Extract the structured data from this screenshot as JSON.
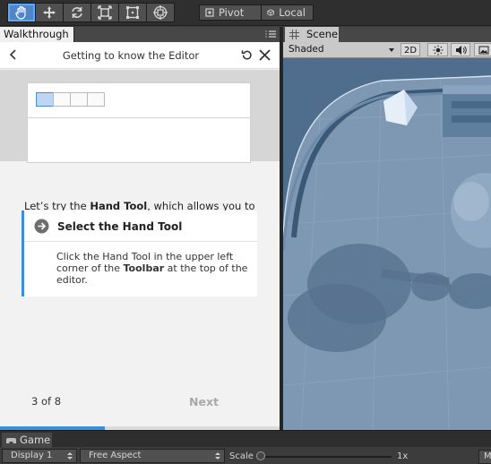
{
  "toolbar": {
    "pivot_label": "Pivot",
    "local_label": "Local",
    "accent": "#4e86c8"
  },
  "walkthrough": {
    "tab_label": "Walkthrough",
    "header_title": "Getting to know the Editor",
    "lead_prefix": "Let’s try the ",
    "lead_bold": "Hand Tool",
    "lead_suffix": ", which allows you to navigate your view of the scene.",
    "task": {
      "title": "Select the Hand Tool",
      "body_prefix": "Click the Hand Tool in the upper left corner of the ",
      "body_bold": "Toolbar",
      "body_suffix": " at the top of the editor."
    },
    "step_counter": "3 of 8",
    "next_label": "Next",
    "progress": 0.375
  },
  "scene": {
    "tab_label": "Scene",
    "shading_mode": "Shaded",
    "mode_2d_label": "2D"
  },
  "game": {
    "tab_label": "Game",
    "display_select": "Display 1",
    "aspect_select": "Free Aspect",
    "scale_label": "Scale",
    "scale_value": "1x",
    "scale_fraction": 0.0,
    "maximize_label": "Ma"
  }
}
